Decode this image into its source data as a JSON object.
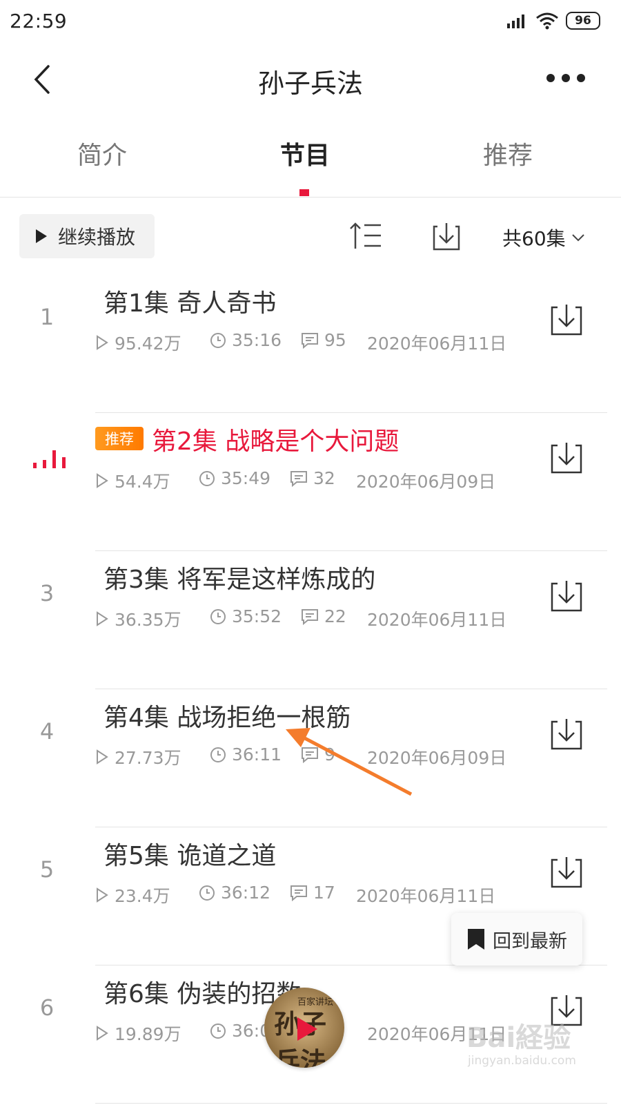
{
  "status_bar": {
    "time": "22:59",
    "battery": "96"
  },
  "header": {
    "title": "孙子兵法",
    "back_icon": "back-chevron-icon",
    "more_icon": "more-dots-icon"
  },
  "tabs": [
    {
      "label": "简介",
      "active": false
    },
    {
      "label": "节目",
      "active": true
    },
    {
      "label": "推荐",
      "active": false
    }
  ],
  "toolbar": {
    "continue_label": "继续播放",
    "count_label": "共60集"
  },
  "episodes": [
    {
      "number": "1",
      "title": "第1集 奇人奇书",
      "plays": "95.42万",
      "duration": "35:16",
      "comments": "95",
      "date": "2020年06月11日",
      "playing": false,
      "badge": ""
    },
    {
      "number": "",
      "title": "第2集 战略是个大问题",
      "plays": "54.4万",
      "duration": "35:49",
      "comments": "32",
      "date": "2020年06月09日",
      "playing": true,
      "badge": "推荐"
    },
    {
      "number": "3",
      "title": "第3集 将军是这样炼成的",
      "plays": "36.35万",
      "duration": "35:52",
      "comments": "22",
      "date": "2020年06月11日",
      "playing": false,
      "badge": ""
    },
    {
      "number": "4",
      "title": "第4集 战场拒绝一根筋",
      "plays": "27.73万",
      "duration": "36:11",
      "comments": "9",
      "date": "2020年06月09日",
      "playing": false,
      "badge": ""
    },
    {
      "number": "5",
      "title": "第5集 诡道之道",
      "plays": "23.4万",
      "duration": "36:12",
      "comments": "17",
      "date": "2020年06月11日",
      "playing": false,
      "badge": ""
    },
    {
      "number": "6",
      "title": "第6集 伪装的招数",
      "plays": "19.89万",
      "duration": "36:0",
      "comments": "",
      "date": "2020年06月11日",
      "playing": false,
      "badge": ""
    }
  ],
  "floating": {
    "back_to_latest": "回到最新"
  },
  "player": {
    "cover_text": "孙子兵法",
    "cover_sub": "百家讲坛"
  },
  "watermark": {
    "main": "Bai経验",
    "sub": "jingyan.baidu.com"
  },
  "colors": {
    "accent": "#e8193c",
    "badge": "#ff8a00",
    "annotation_arrow": "#f47c2c"
  }
}
